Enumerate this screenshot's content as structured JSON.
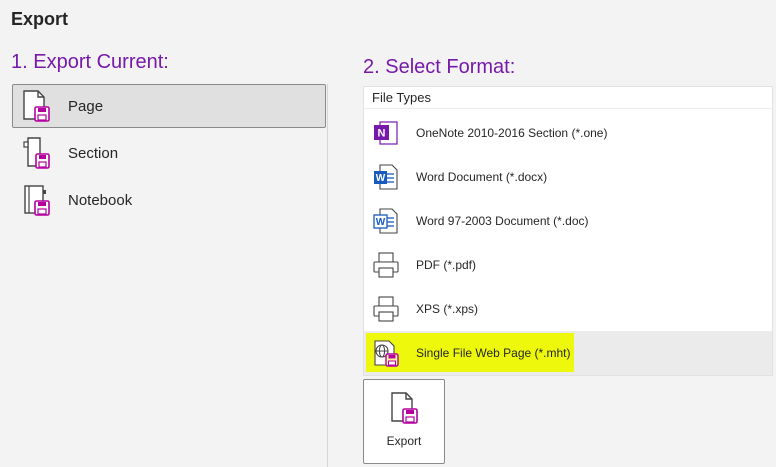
{
  "page": {
    "title": "Export"
  },
  "export_current": {
    "heading": "1. Export Current:",
    "items": [
      {
        "label": "Page",
        "icon": "page-icon",
        "selected": true
      },
      {
        "label": "Section",
        "icon": "section-icon",
        "selected": false
      },
      {
        "label": "Notebook",
        "icon": "notebook-icon",
        "selected": false
      }
    ]
  },
  "select_format": {
    "heading": "2. Select Format:",
    "list_header": "File Types",
    "items": [
      {
        "label": "OneNote 2010-2016 Section (*.one)",
        "icon": "onenote-icon",
        "selected": false
      },
      {
        "label": "Word Document (*.docx)",
        "icon": "word-docx-icon",
        "selected": false
      },
      {
        "label": "Word 97-2003 Document (*.doc)",
        "icon": "word-doc-icon",
        "selected": false
      },
      {
        "label": "PDF (*.pdf)",
        "icon": "printer-icon",
        "selected": false
      },
      {
        "label": "XPS (*.xps)",
        "icon": "printer-icon",
        "selected": false
      },
      {
        "label": "Single File Web Page (*.mht)",
        "icon": "web-page-icon",
        "selected": true
      }
    ]
  },
  "export_button": {
    "label": "Export"
  },
  "colors": {
    "heading": "#7719aa",
    "onenote": "#7719aa",
    "word": "#185abd",
    "highlight": "#eef900",
    "save_badge": "#b4009e"
  }
}
